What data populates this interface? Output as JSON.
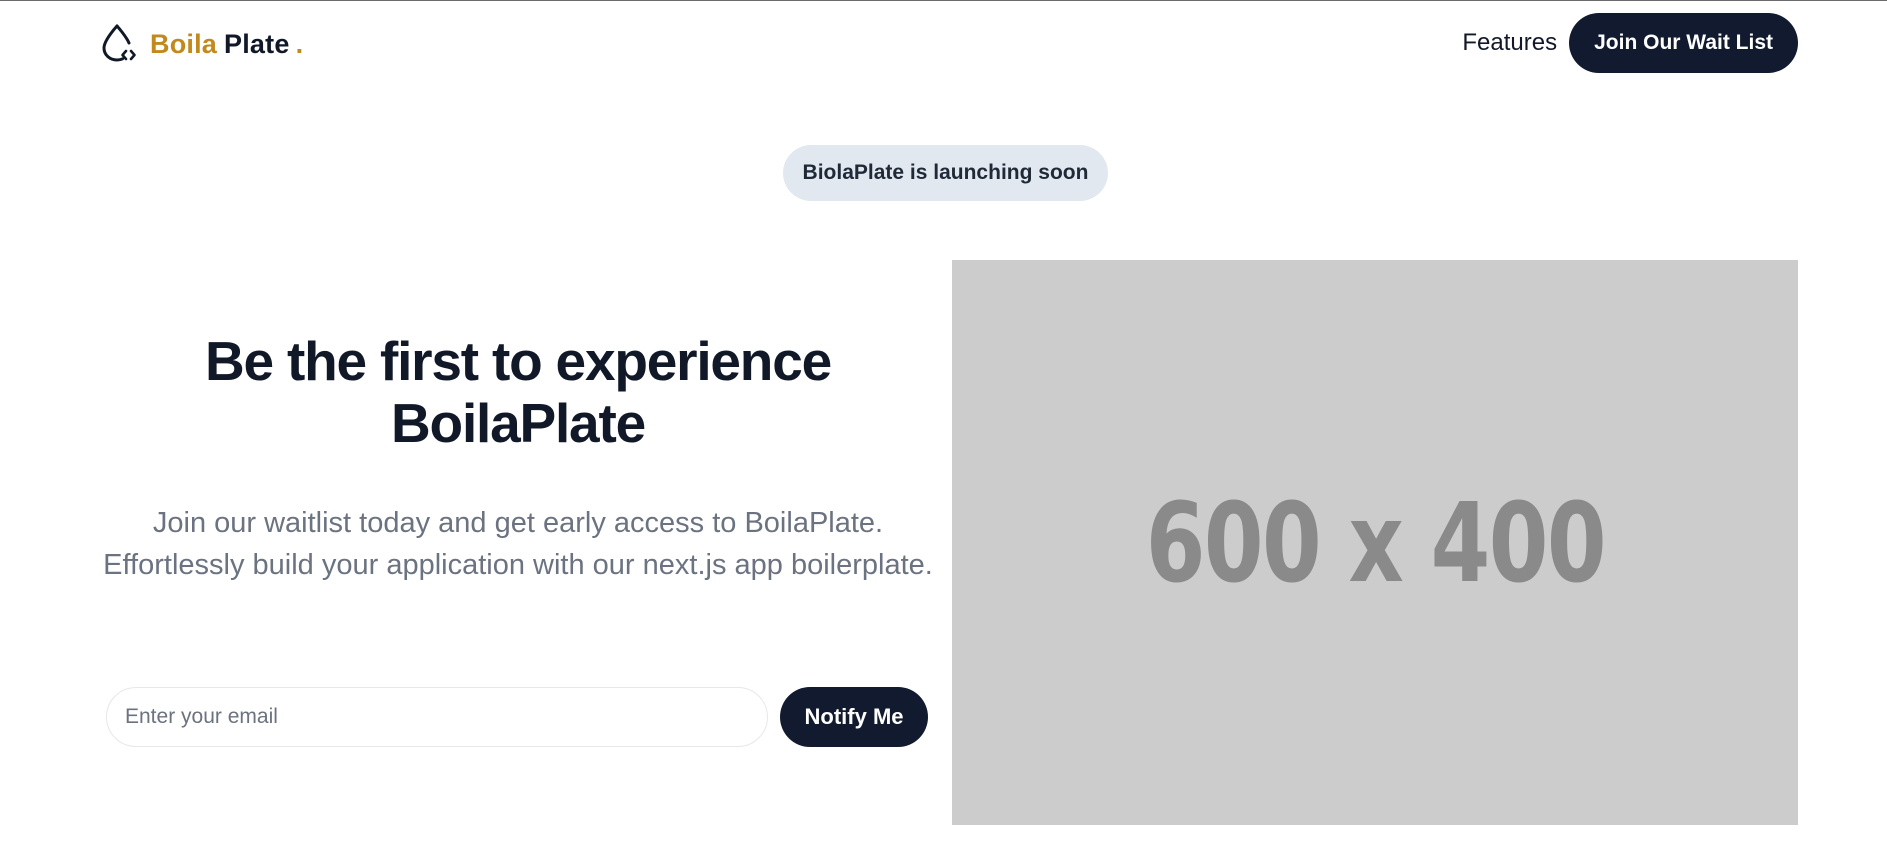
{
  "header": {
    "brand": {
      "word1": "Boila",
      "word2": "Plate",
      "dot": ".",
      "icon": "droplet-code-icon"
    },
    "nav": {
      "features": "Features",
      "cta": "Join Our Wait List"
    }
  },
  "announcement": "BiolaPlate is launching soon",
  "hero": {
    "headline_line1": "Be the first to experience",
    "headline_line2": "BoilaPlate",
    "subtext": "Join our waitlist today and get early access to BoilaPlate. Effortlessly build your application with our next.js app boilerplate.",
    "email_placeholder": "Enter your email",
    "email_value": "",
    "notify_label": "Notify Me",
    "image_caption": "600 x 400"
  },
  "colors": {
    "brand_accent": "#c28a1e",
    "button_dark": "#111a2e",
    "pill_bg": "#e2e8f0",
    "placeholder_bg": "#cccccc"
  }
}
